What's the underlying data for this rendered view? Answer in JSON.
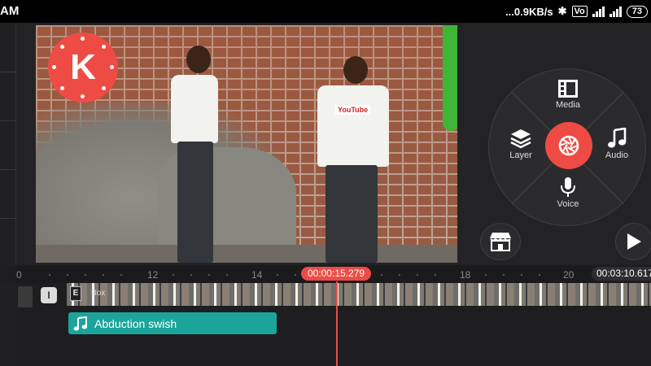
{
  "status_bar": {
    "time": "AM",
    "network_speed": "...0.9KB/s",
    "battery": "73",
    "icons": [
      "bluetooth-icon",
      "volte-icon",
      "signal-4g-icon",
      "signal-icon",
      "battery-icon"
    ]
  },
  "preview": {
    "logo_letter": "K",
    "shirt_print": "YouTube"
  },
  "radial_menu": {
    "media_label": "Media",
    "layer_label": "Layer",
    "audio_label": "Audio",
    "voice_label": "Voice",
    "center_icon": "camera-shutter-icon"
  },
  "buttons": {
    "store_icon": "store-icon",
    "play_icon": "play-icon"
  },
  "timeline": {
    "ticks": [
      "0",
      "12",
      "14",
      "16",
      "18",
      "20"
    ],
    "current_time": "00:00:15.279",
    "total_time": "00:03:10.617",
    "clip_label": "Box",
    "mute_label": "I",
    "clip_badge": "E",
    "audio_clip_label": "Abduction swish"
  },
  "colors": {
    "accent": "#ef4b45",
    "audio_clip": "#1ba59a",
    "panel": "#2b2b2e"
  }
}
